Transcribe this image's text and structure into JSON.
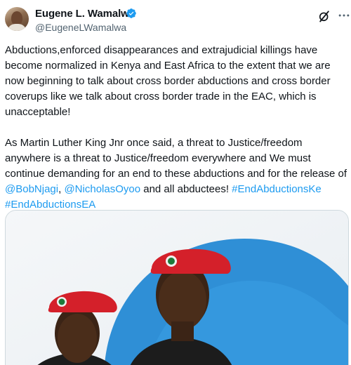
{
  "author": {
    "name": "Eugene L. Wamalwa",
    "handle": "@EugeneLWamalwa",
    "verified": true,
    "avatar_icon": "profile-photo-avatar"
  },
  "header_actions": {
    "grok_icon": "grok-slash-icon",
    "more_icon": "more-dots-icon"
  },
  "tweet": {
    "paragraph1": "Abductions,enforced disappearances and extrajudicial killings have become normalized in Kenya and East Africa to the extent that we are now beginning to talk about cross border abductions and cross border coverups like we talk about cross border trade in the EAC, which is unacceptable!",
    "paragraph2_intro": "As Martin Luther King Jnr once said, a threat to Justice/freedom anywhere is a threat to Justice/freedom everywhere and We must continue demanding for an end to these abductions and for the release of ",
    "mention1": "@BobNjagi",
    "sep1": ", ",
    "mention2": "@NicholasOyoo",
    "mid": " and all abductees! ",
    "hashtag1": "#EndAbductionsKe",
    "space": " ",
    "hashtag2": "#EndAbductionsEA"
  },
  "media": {
    "description_icon": "photo-two-men-red-berets",
    "colors": {
      "accent_blue": "#1d9bf0",
      "beret_red": "#d4202a"
    }
  }
}
